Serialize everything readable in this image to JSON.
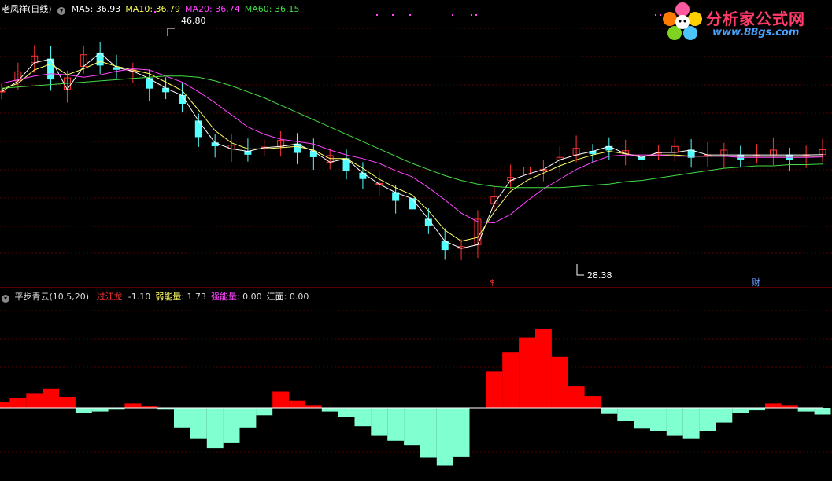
{
  "main_panel": {
    "stock_name": "老凤祥",
    "period": "(日线)",
    "ma": [
      {
        "label": "MA5:",
        "value": "36.93",
        "color": "#ffffff"
      },
      {
        "label": "MA10:",
        "value": "36.79",
        "color": "#ffff66"
      },
      {
        "label": "MA20:",
        "value": "36.74",
        "color": "#ff44ff"
      },
      {
        "label": "MA60:",
        "value": "36.15",
        "color": "#44dd44"
      }
    ],
    "high_label": "46.80",
    "low_label": "28.38",
    "marker_s": "$",
    "marker_cai": "财"
  },
  "sub_panel": {
    "indicator_name": "平步青云(10,5,20)",
    "items": [
      {
        "label": "过江龙:",
        "value": "-1.10",
        "color": "#ff3333"
      },
      {
        "label": "弱能量:",
        "value": "1.73",
        "color": "#ffff66"
      },
      {
        "label": "强能量:",
        "value": "0.00",
        "color": "#ff44ff"
      },
      {
        "label": "江面:",
        "value": "0.00",
        "color": "#ffffff"
      }
    ]
  },
  "logo": {
    "text": "分析家公式网",
    "url": "www.88gs.com"
  },
  "chart_data": [
    {
      "type": "line",
      "title": "",
      "x": [
        0,
        1,
        2,
        3,
        4,
        5,
        6,
        7,
        8,
        9,
        10,
        11,
        12,
        13,
        14,
        15,
        16,
        17,
        18,
        19,
        20,
        21,
        22,
        23,
        24,
        25,
        26,
        27,
        28,
        29,
        30,
        31,
        32,
        33,
        34,
        35,
        36,
        37,
        38,
        39,
        40,
        41,
        42,
        43,
        44,
        45,
        46,
        47,
        48,
        49,
        50
      ],
      "series": [
        {
          "name": "MA5",
          "color": "#ffffff",
          "values": [
            42.1,
            43.0,
            44.5,
            44.8,
            42.3,
            44.2,
            45.3,
            44.1,
            43.8,
            43.2,
            42.4,
            41.8,
            39.7,
            37.9,
            37.4,
            37.2,
            37.5,
            37.6,
            37.8,
            37.2,
            36.3,
            36.6,
            35.4,
            34.5,
            33.8,
            33.3,
            31.6,
            29.8,
            29.2,
            29.5,
            32.9,
            34.8,
            35.3,
            35.7,
            36.5,
            36.9,
            37.2,
            37.6,
            37.0,
            36.7,
            37.1,
            37.1,
            37.3,
            36.9,
            36.9,
            36.9,
            36.9,
            36.9,
            36.9,
            36.9,
            36.93
          ]
        },
        {
          "name": "MA10",
          "color": "#ffff66",
          "values": [
            42.3,
            42.8,
            43.9,
            44.4,
            43.5,
            44.0,
            44.6,
            44.2,
            43.9,
            43.6,
            42.9,
            42.2,
            40.6,
            38.9,
            37.9,
            37.4,
            37.4,
            37.5,
            37.6,
            37.3,
            36.6,
            36.6,
            35.8,
            34.9,
            34.2,
            33.6,
            32.3,
            30.7,
            29.8,
            30.1,
            32.2,
            33.9,
            34.8,
            35.4,
            36.0,
            36.5,
            36.9,
            37.2,
            37.0,
            36.8,
            36.9,
            36.9,
            36.8,
            36.8,
            36.8,
            36.8,
            36.8,
            36.8,
            36.8,
            36.8,
            36.79
          ]
        },
        {
          "name": "MA20",
          "color": "#ff44ff",
          "values": [
            42.8,
            43.1,
            43.4,
            43.6,
            43.5,
            43.3,
            43.5,
            43.8,
            44.0,
            43.9,
            43.4,
            42.9,
            42.1,
            41.2,
            40.2,
            39.2,
            38.6,
            38.2,
            38.0,
            37.8,
            37.3,
            36.9,
            36.6,
            36.2,
            35.6,
            35.1,
            34.2,
            33.2,
            32.1,
            31.4,
            31.3,
            32.0,
            33.1,
            34.1,
            34.9,
            35.7,
            36.3,
            36.8,
            36.9,
            36.9,
            36.9,
            36.8,
            36.8,
            36.8,
            36.8,
            36.7,
            36.7,
            36.7,
            36.7,
            36.7,
            36.74
          ]
        },
        {
          "name": "MA60",
          "color": "#44dd44",
          "values": [
            42.4,
            42.5,
            42.6,
            42.7,
            42.8,
            42.9,
            43.0,
            43.1,
            43.2,
            43.3,
            43.4,
            43.4,
            43.3,
            43.0,
            42.6,
            42.1,
            41.6,
            41.0,
            40.4,
            39.8,
            39.2,
            38.6,
            38.0,
            37.4,
            36.8,
            36.2,
            35.7,
            35.2,
            34.8,
            34.5,
            34.3,
            34.2,
            34.2,
            34.2,
            34.2,
            34.3,
            34.4,
            34.5,
            34.7,
            34.8,
            35.0,
            35.2,
            35.4,
            35.6,
            35.8,
            35.9,
            36.0,
            36.0,
            36.1,
            36.1,
            36.15
          ]
        }
      ],
      "ylim": [
        27.0,
        48.5
      ]
    },
    {
      "type": "bar",
      "title": "",
      "categories": [
        0,
        1,
        2,
        3,
        4,
        5,
        6,
        7,
        8,
        9,
        10,
        11,
        12,
        13,
        14,
        15,
        16,
        17,
        18,
        19,
        20,
        21,
        22,
        23,
        24,
        25,
        26,
        27,
        28,
        29,
        30,
        31,
        32,
        33,
        34,
        35,
        36,
        37,
        38,
        39,
        40,
        41,
        42,
        43,
        44,
        45,
        46,
        47,
        48,
        49,
        50
      ],
      "values": [
        0.8,
        1.4,
        2.0,
        2.6,
        1.5,
        -0.9,
        -0.6,
        -0.3,
        0.6,
        0.2,
        -0.3,
        -3.2,
        -5.0,
        -6.6,
        -5.8,
        -3.2,
        -1.2,
        2.2,
        1.0,
        0.4,
        -0.6,
        -1.5,
        -3.0,
        -4.6,
        -5.4,
        -6.1,
        -8.2,
        -9.5,
        -8.0,
        0.0,
        5.0,
        7.6,
        9.6,
        10.8,
        7.0,
        3.0,
        1.6,
        -1.0,
        -2.2,
        -3.4,
        -3.8,
        -4.6,
        -5.0,
        -3.8,
        -2.4,
        -0.8,
        -0.4,
        0.6,
        0.4,
        -0.6,
        -1.1
      ],
      "ylim": [
        -11.5,
        14.5
      ]
    }
  ]
}
